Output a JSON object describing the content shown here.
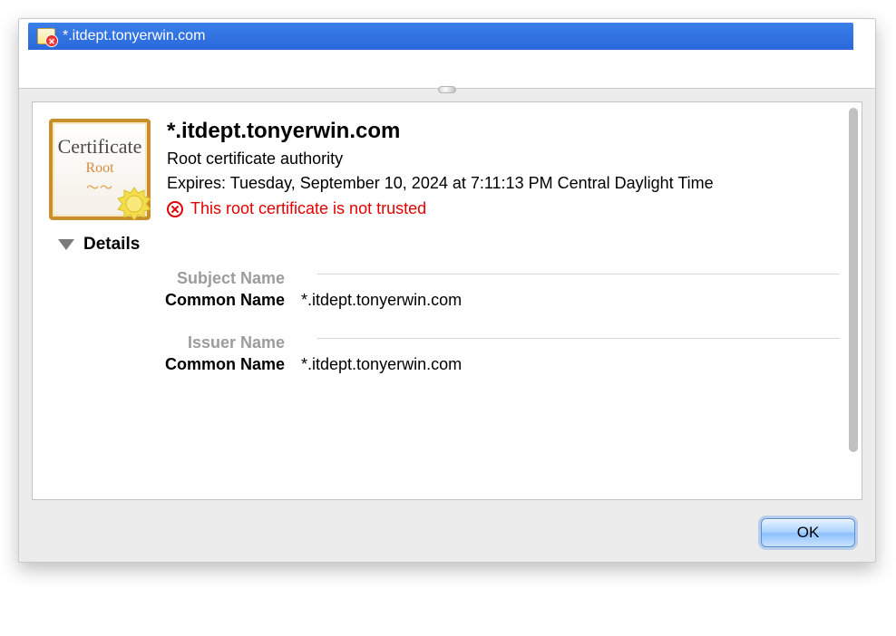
{
  "tab": {
    "title": "*.itdept.tonyerwin.com"
  },
  "certificate": {
    "icon_label_top": "Certificate",
    "icon_label_bottom": "Root",
    "title": "*.itdept.tonyerwin.com",
    "subtitle": "Root certificate authority",
    "expires": "Expires: Tuesday, September 10, 2024 at 7:11:13 PM Central Daylight Time",
    "trust_message": "This root certificate is not trusted"
  },
  "details": {
    "heading": "Details",
    "sections": {
      "subject": {
        "title": "Subject Name",
        "common_name_label": "Common Name",
        "common_name_value": "*.itdept.tonyerwin.com"
      },
      "issuer": {
        "title": "Issuer Name",
        "common_name_label": "Common Name",
        "common_name_value": "*.itdept.tonyerwin.com"
      }
    }
  },
  "buttons": {
    "ok": "OK"
  }
}
